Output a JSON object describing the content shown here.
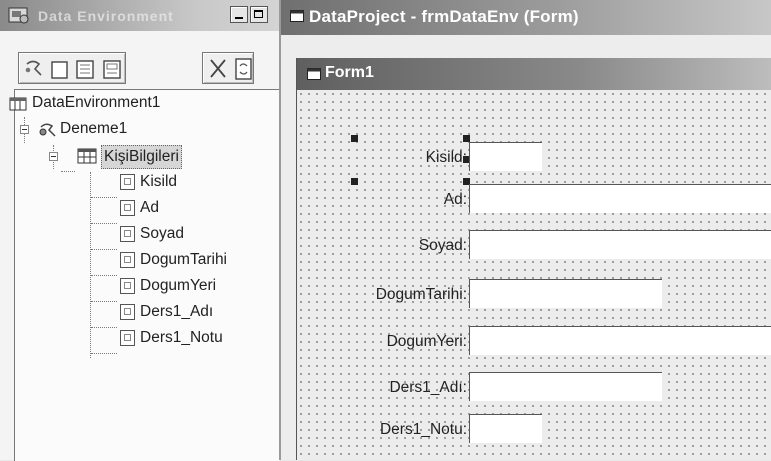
{
  "left_window": {
    "title": "Data Environment",
    "toolbar": [
      "add-connection",
      "add-command",
      "view-code",
      "properties",
      "delete",
      "refresh"
    ],
    "tree": {
      "root": "DataEnvironment1",
      "connection": "Deneme1",
      "command": "KişiBilgileri",
      "fields": [
        "Kisild",
        "Ad",
        "Soyad",
        "DogumTarihi",
        "DogumYeri",
        "Ders1_Adı",
        "Ders1_Notu"
      ]
    }
  },
  "form_window": {
    "title": "DataProject - frmDataEnv (Form)",
    "form_title": "Form1",
    "fields": [
      {
        "label": "Kisild:",
        "value": ""
      },
      {
        "label": "Ad:",
        "value": ""
      },
      {
        "label": "Soyad:",
        "value": ""
      },
      {
        "label": "DogumTarihi:",
        "value": ""
      },
      {
        "label": "DogumYeri:",
        "value": ""
      },
      {
        "label": "Ders1_Adı:",
        "value": ""
      },
      {
        "label": "Ders1_Notu:",
        "value": ""
      }
    ]
  }
}
